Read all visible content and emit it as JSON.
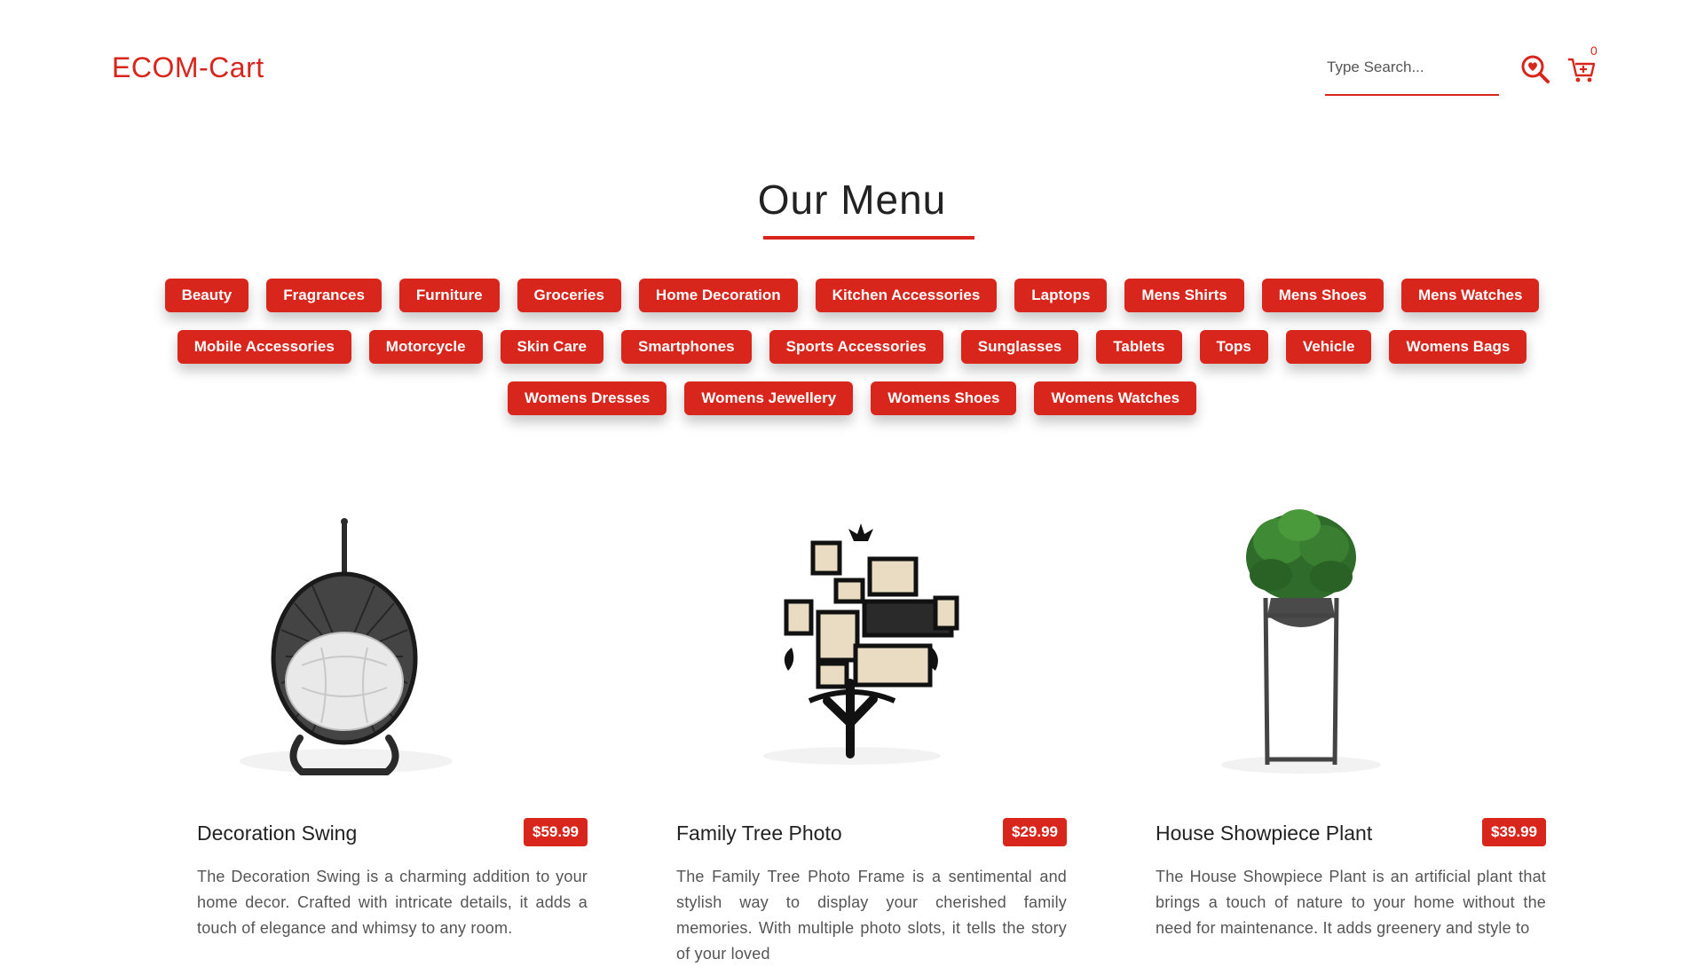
{
  "header": {
    "logo": "ECOM-Cart",
    "search_placeholder": "Type Search...",
    "cart_count": "0"
  },
  "menu": {
    "title": "Our Menu",
    "rows": [
      [
        "Beauty",
        "Fragrances",
        "Furniture",
        "Groceries",
        "Home Decoration",
        "Kitchen Accessories",
        "Laptops",
        "Mens Shirts",
        "Mens Shoes",
        "Mens Watches"
      ],
      [
        "Mobile Accessories",
        "Motorcycle",
        "Skin Care",
        "Smartphones",
        "Sports Accessories",
        "Sunglasses",
        "Tablets",
        "Tops",
        "Vehicle",
        "Womens Bags"
      ],
      [
        "Womens Dresses",
        "Womens Jewellery",
        "Womens Shoes",
        "Womens Watches"
      ]
    ]
  },
  "products": [
    {
      "name": "Decoration Swing",
      "price": "$59.99",
      "description": "The Decoration Swing is a charming addition to your home decor. Crafted with intricate details, it adds a touch of elegance and whimsy to any room.",
      "icon": "swing-chair-image"
    },
    {
      "name": "Family Tree Photo",
      "price": "$29.99",
      "description": "The Family Tree Photo Frame is a sentimental and stylish way to display your cherished family memories. With multiple photo slots, it tells the story of your loved",
      "icon": "family-tree-frame-image"
    },
    {
      "name": "House Showpiece Plant",
      "price": "$39.99",
      "description": "The House Showpiece Plant is an artificial plant that brings a touch of nature to your home without the need for maintenance. It adds greenery and style to",
      "icon": "potted-plant-image"
    }
  ],
  "colors": {
    "accent": "#d9261c",
    "text": "#2b2b2b",
    "muted": "#555555"
  }
}
